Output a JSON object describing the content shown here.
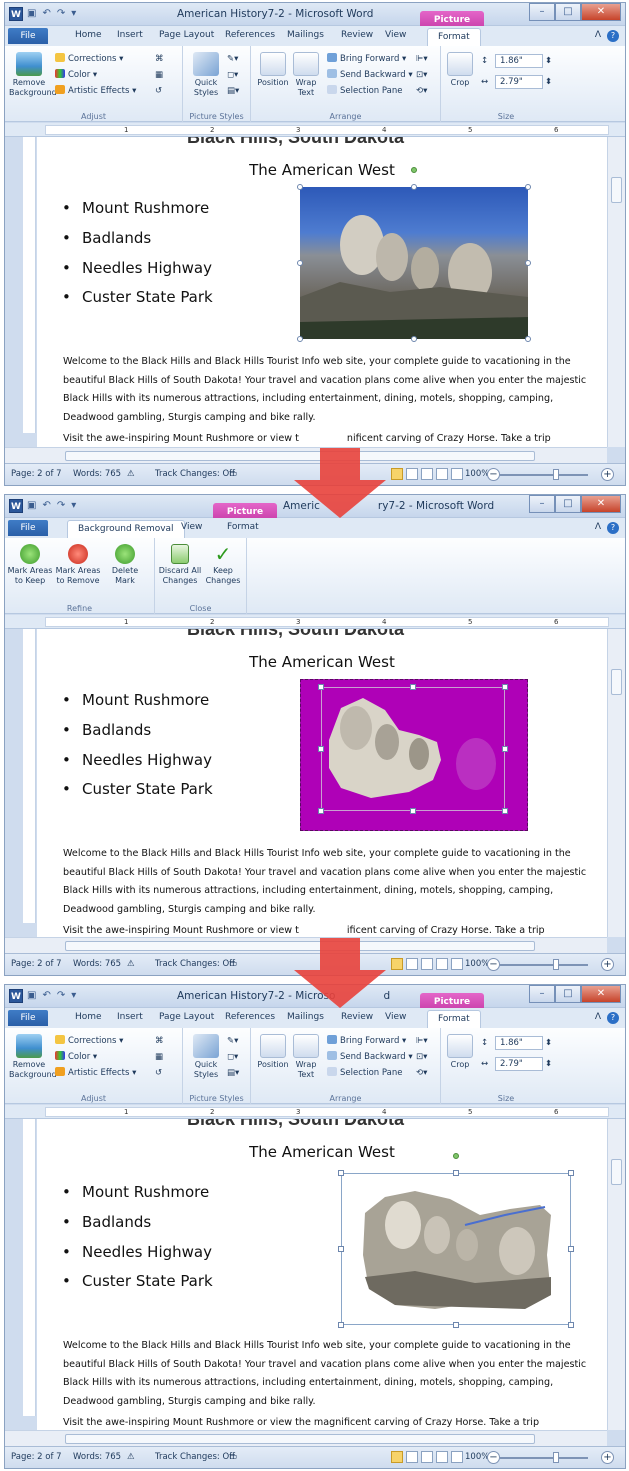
{
  "window": {
    "title": "American History7-2 - Microsoft Word",
    "title_cut_left": "Americ",
    "title_cut_right": "ry7-2 - Microsoft Word",
    "title3_left": "American History7-2 - Microso",
    "title3_right": "d",
    "picture_tools": "Picture Tools",
    "app_icon": "W"
  },
  "tabs": {
    "file": "File",
    "home": "Home",
    "insert": "Insert",
    "page_layout": "Page Layout",
    "references": "References",
    "mailings": "Mailings",
    "review": "Review",
    "view": "View",
    "format": "Format",
    "background_removal": "Background Removal"
  },
  "ribbon": {
    "remove_background": "Remove Background",
    "corrections": "Corrections",
    "color": "Color",
    "artistic_effects": "Artistic Effects",
    "adjust": "Adjust",
    "quick_styles": "Quick Styles",
    "picture_styles": "Picture Styles",
    "position": "Position",
    "wrap_text": "Wrap Text",
    "bring_forward": "Bring Forward",
    "send_backward": "Send Backward",
    "selection_pane": "Selection Pane",
    "arrange": "Arrange",
    "crop": "Crop",
    "height": "1.86\"",
    "width": "2.79\"",
    "size": "Size"
  },
  "bgribbon": {
    "mark_keep": "Mark Areas to Keep",
    "mark_remove": "Mark Areas to Remove",
    "delete_mark": "Delete Mark",
    "refine": "Refine",
    "discard": "Discard All Changes",
    "keep": "Keep Changes",
    "close": "Close"
  },
  "ruler": {
    "n1": "1",
    "n2": "2",
    "n3": "3",
    "n4": "4",
    "n5": "5",
    "n6": "6"
  },
  "document": {
    "heading_cut": "Black Hills, South Dakota",
    "subtitle": "The American West",
    "bullets": [
      "Mount Rushmore",
      "Badlands",
      "Needles Highway",
      "Custer State Park"
    ],
    "para": "Welcome to the Black Hills and Black Hills Tourist Info web site, your complete guide to vacationing in the beautiful Black Hills of South Dakota! Your travel and vacation plans come alive when you enter the majestic Black Hills with its numerous attractions, including entertainment, dining, motels, shopping, camping, Deadwood gambling, Sturgis camping and bike rally.",
    "para2_left": "Visit the awe-inspiring  Mount Rushmore or view t",
    "para2_right": "nificent carving of Crazy Horse. Take a trip",
    "para2_left_b": "Visit the awe-inspiring  Mount Rushmore or view t",
    "para2_right_b": "ificent carving of Crazy Horse. Take a trip",
    "para2_full": "Visit the awe-inspiring  Mount Rushmore or view the magnificent carving of Crazy Horse. Take a trip"
  },
  "status": {
    "page": "Page: 2 of 7",
    "words": "Words: 765",
    "track": "Track Changes: Off",
    "zoom": "100%"
  },
  "colors": {
    "accent": "#2b579a",
    "picture_tools": "#d04fb5",
    "removal_overlay": "#b000b8",
    "arrow": "#e8413b"
  }
}
